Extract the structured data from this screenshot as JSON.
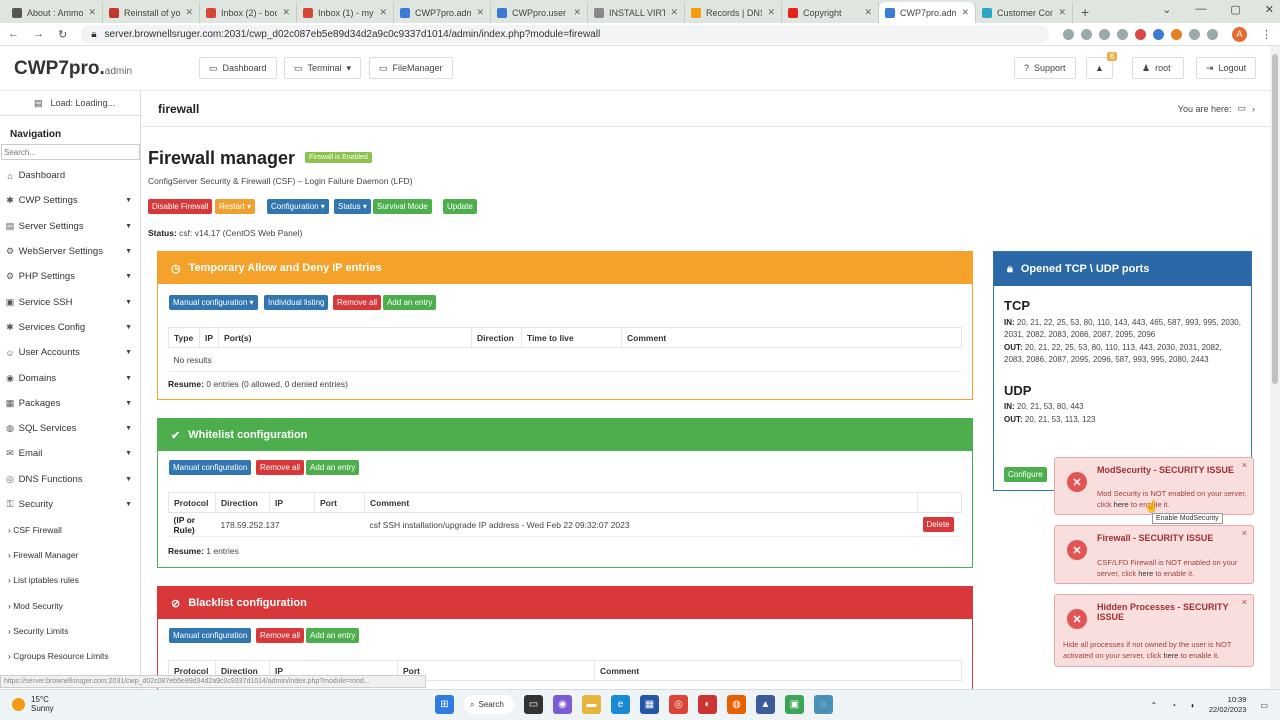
{
  "browser": {
    "tabs": [
      {
        "label": "About : Ammo",
        "color": "#555"
      },
      {
        "label": "Reinstall of you",
        "color": "#c0392b"
      },
      {
        "label": "Inbox (2) - boo",
        "color": "#d44638"
      },
      {
        "label": "Inbox (1) - myr",
        "color": "#d44638"
      },
      {
        "label": "CWP7pro.adm",
        "color": "#3a7bd5"
      },
      {
        "label": "CWPpro.user [s",
        "color": "#3a7bd5"
      },
      {
        "label": "INSTALL VIRTU",
        "color": "#888"
      },
      {
        "label": "Records | DNS",
        "color": "#f39c12"
      },
      {
        "label": "Copyright ",
        "color": "#e62117"
      },
      {
        "label": "CWP7pro.adm",
        "color": "#3a7bd5"
      },
      {
        "label": "Customer Cont",
        "color": "#2aa6c5"
      }
    ],
    "url": "server.brownellsruger.com:2031/cwp_d02c087eb5e89d34d2a9c0c9337d1014/admin/index.php?module=firewall",
    "avatar": "A"
  },
  "header": {
    "logo": "CWP7pro.",
    "logo_small": "admin",
    "dashboard": "Dashboard",
    "terminal": "Terminal",
    "filemanager": "FileManager",
    "support": "Support",
    "notif_count": "6",
    "user": "root",
    "logout": "Logout"
  },
  "sidebar": {
    "loading": "Load: Loading...",
    "nav_title": "Navigation",
    "search_placeholder": "Search...",
    "items": [
      {
        "label": "Dashboard",
        "icon": "⌂",
        "caret": ""
      },
      {
        "label": "CWP Settings",
        "icon": "✱",
        "caret": "▼"
      },
      {
        "label": "Server Settings",
        "icon": "▤",
        "caret": "▼"
      },
      {
        "label": "WebServer Settings",
        "icon": "⚙",
        "caret": "▼"
      },
      {
        "label": "PHP Settings",
        "icon": "⚙",
        "caret": "▼"
      },
      {
        "label": "Service SSH",
        "icon": "▣",
        "caret": "▼"
      },
      {
        "label": "Services Config",
        "icon": "✱",
        "caret": "▼"
      },
      {
        "label": "User Accounts",
        "icon": "☺",
        "caret": "▼"
      },
      {
        "label": "Domains",
        "icon": "◉",
        "caret": "▼"
      },
      {
        "label": "Packages",
        "icon": "▦",
        "caret": "▼"
      },
      {
        "label": "SQL Services",
        "icon": "◍",
        "caret": "▼"
      },
      {
        "label": "Email",
        "icon": "✉",
        "caret": "▼"
      },
      {
        "label": "DNS Functions",
        "icon": "◎",
        "caret": "▼"
      },
      {
        "label": "Security",
        "icon": "⚿",
        "caret": "▼"
      }
    ],
    "subitems": [
      "CSF Firewall",
      "Firewall Manager",
      "List iptables rules",
      "Mod Security",
      "Security Limits",
      "Cgroups Resource Limits",
      "CWP Secure Kernel"
    ]
  },
  "crumb": {
    "title": "firewall",
    "you_are_here": "You are here:"
  },
  "page": {
    "title": "Firewall manager",
    "enabled_label": "Firewall is Enabled",
    "subtitle": "ConfigServer Security & Firewall (CSF) – Login Failure Daemon (LFD)",
    "buttons": {
      "disable": "Disable Firewall",
      "restart": "Restart ▾",
      "configuration": "Configuration ▾",
      "status": "Status ▾",
      "survival": "Survival Mode",
      "update": "Update"
    },
    "status_label": "Status:",
    "status_value": " csf: v14.17 (CentOS Web Panel)"
  },
  "temp": {
    "title": "Temporary Allow and Deny IP entries",
    "buttons": {
      "manual": "Manual configuration ▾",
      "individual": "Individual listing",
      "remove": "Remove all",
      "add": "Add an entry"
    },
    "headers": [
      "Type",
      "IP",
      "Port(s)",
      "Direction",
      "Time to live",
      "Comment"
    ],
    "empty": "No results",
    "resume_label": "Resume:",
    "resume_value": " 0 entries (0 allowed, 0 denied entries)"
  },
  "whitelist": {
    "title": "Whitelist configuration",
    "buttons": {
      "manual": "Manual configuration",
      "remove": "Remove all",
      "add": "Add an entry"
    },
    "headers": [
      "Protocol",
      "Direction",
      "IP",
      "Port",
      "Comment"
    ],
    "row": {
      "protocol": "(IP or Rule)",
      "ip": "178.59.252.137",
      "comment": "csf SSH installation/upgrade IP address - Wed Feb 22 09:32:07 2023",
      "delete": "Delete"
    },
    "resume_label": "Resume:",
    "resume_value": " 1 entries"
  },
  "blacklist": {
    "title": "Blacklist configuration",
    "buttons": {
      "manual": "Manual configuration",
      "remove": "Remove all",
      "add": "Add an entry"
    },
    "headers": [
      "Protocol",
      "Direction",
      "IP",
      "Port",
      "Comment"
    ]
  },
  "ports": {
    "title": "Opened TCP \\ UDP ports",
    "tcp": "TCP",
    "in_label": "IN:",
    "out_label": "OUT:",
    "tcp_in": " 20, 21, 22, 25, 53, 80, 110, 143, 443, 465, 587, 993, 995, 2030, 2031, 2082, 2083, 2086, 2087, 2095, 2096",
    "tcp_out": " 20, 21, 22, 25, 53, 80, 110, 113, 443, 2030, 2031, 2082, 2083, 2086, 2087, 2095, 2096, 587, 993, 995, 2080, 2443",
    "udp": "UDP",
    "udp_in": " 20, 21, 53, 80, 443",
    "udp_out": " 20, 21, 53, 113, 123",
    "configure": "Configure"
  },
  "notifications": [
    {
      "title": "ModSecurity - SECURITY ISSUE",
      "body": "Mod Security is NOT enabled on your server, click ",
      "link": "here",
      "tail": " to enable it."
    },
    {
      "title": "Firewall - SECURITY ISSUE",
      "body": "CSF/LFD Firewall is NOT enabled on your server, click ",
      "link": "here",
      "tail": " to enable it."
    },
    {
      "title": "Hidden Processes - SECURITY ISSUE",
      "body": "Hide all processes if not owned by the user is NOT activated on your server, click ",
      "link": "here",
      "tail": " to enable it."
    }
  ],
  "tooltip": "Enable ModSecurity",
  "statusbar_url": "https://server.brownellsruger.com:2031/cwp_d02c087eb5e89d34d2a9c0c9337d1014/admin/index.php?module=mod...",
  "taskbar": {
    "temp": "15°C",
    "weather": "Sunny",
    "search": "Search",
    "time": "10:39",
    "date": "22/02/2023"
  },
  "colors": {
    "orange": "#f5a22b",
    "green": "#4cae4c",
    "red": "#d9383a",
    "blue": "#3276b1"
  }
}
